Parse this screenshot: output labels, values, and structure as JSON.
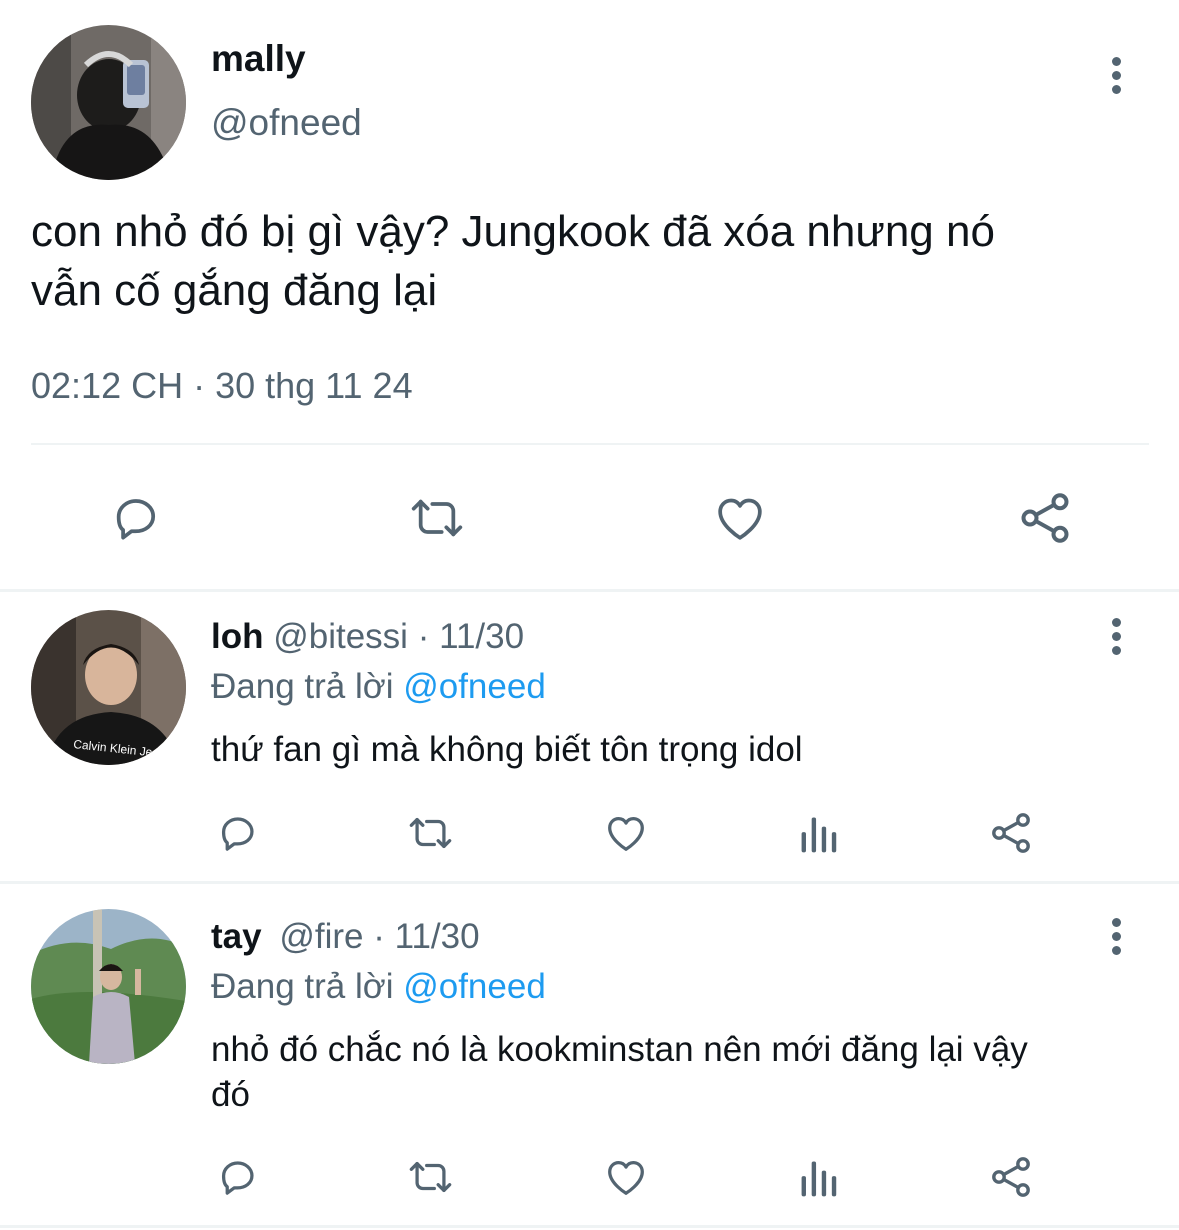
{
  "main_tweet": {
    "display_name": "mally",
    "handle": "@ofneed",
    "text_line1": "con nhỏ đó bị gì vậy? Jungkook đã xóa nhưng nó",
    "text_line2": "vẫn cố gắng đăng lại",
    "timestamp": "02:12 CH · 30 thg 11 24",
    "actions": [
      "reply-icon",
      "retweet-icon",
      "like-icon",
      "share-icon"
    ]
  },
  "replies": [
    {
      "display_name": "loh",
      "handle": "@bitessi",
      "date": "· 11/30",
      "replying_prefix": "Đang trả lời",
      "replying_to": "@ofneed",
      "text_line1": "thứ fan gì mà không biết tôn trọng idol",
      "text_line2": "",
      "avatar_text": "Calvin Klein Jeans"
    },
    {
      "display_name": "tay",
      "handle": "@fire",
      "date": "· 11/30",
      "replying_prefix": "Đang trả lời",
      "replying_to": "@ofneed",
      "text_line1": "nhỏ đó chắc nó là kookminstan nên mới đăng lại vậy",
      "text_line2": "đó",
      "avatar_text": ""
    }
  ],
  "colors": {
    "text": "#0f1419",
    "secondary": "#536471",
    "link": "#1d9bf0",
    "divider": "#eff3f4"
  }
}
